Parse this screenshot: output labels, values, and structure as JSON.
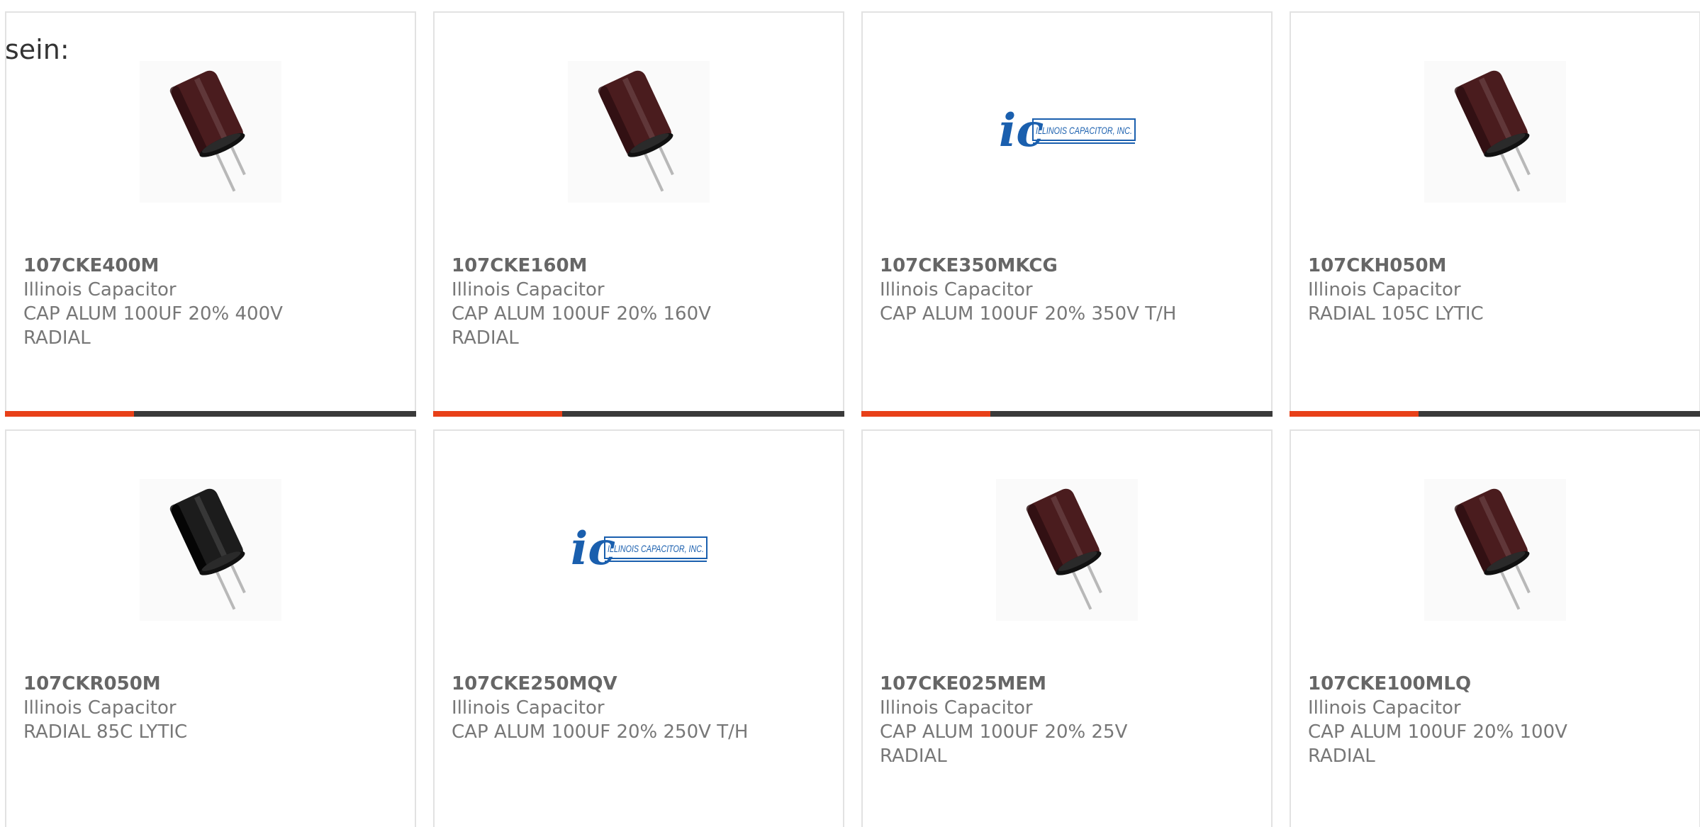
{
  "intro_text": "sein:",
  "colors": {
    "accent": "#e84018",
    "bar": "#3a3a3a",
    "card_border": "#e2e2e2",
    "text": "#777777",
    "logo_blue": "#1a5fae"
  },
  "products": [
    {
      "part": "107CKE400M",
      "manufacturer": "Illinois Capacitor",
      "description": "CAP ALUM 100UF 20% 400V\nRADIAL",
      "image": "capacitor-brown-icon"
    },
    {
      "part": "107CKE160M",
      "manufacturer": "Illinois Capacitor",
      "description": "CAP ALUM 100UF 20% 160V\nRADIAL",
      "image": "capacitor-brown-icon"
    },
    {
      "part": "107CKE350MKCG",
      "manufacturer": "Illinois Capacitor",
      "description": "CAP ALUM 100UF 20% 350V T/H",
      "image": "illinois-capacitor-logo"
    },
    {
      "part": "107CKH050M",
      "manufacturer": "Illinois Capacitor",
      "description": "RADIAL 105C LYTIC",
      "image": "capacitor-brown-icon"
    },
    {
      "part": "107CKR050M",
      "manufacturer": "Illinois Capacitor",
      "description": "RADIAL 85C LYTIC",
      "image": "capacitor-black-icon"
    },
    {
      "part": "107CKE250MQV",
      "manufacturer": "Illinois Capacitor",
      "description": "CAP ALUM 100UF 20% 250V T/H",
      "image": "illinois-capacitor-logo"
    },
    {
      "part": "107CKE025MEM",
      "manufacturer": "Illinois Capacitor",
      "description": "CAP ALUM 100UF 20% 25V\nRADIAL",
      "image": "capacitor-brown-icon"
    },
    {
      "part": "107CKE100MLQ",
      "manufacturer": "Illinois Capacitor",
      "description": "CAP ALUM 100UF 20% 100V\nRADIAL",
      "image": "capacitor-brown-icon"
    }
  ],
  "logo_text": "ILLINOIS CAPACITOR, INC."
}
